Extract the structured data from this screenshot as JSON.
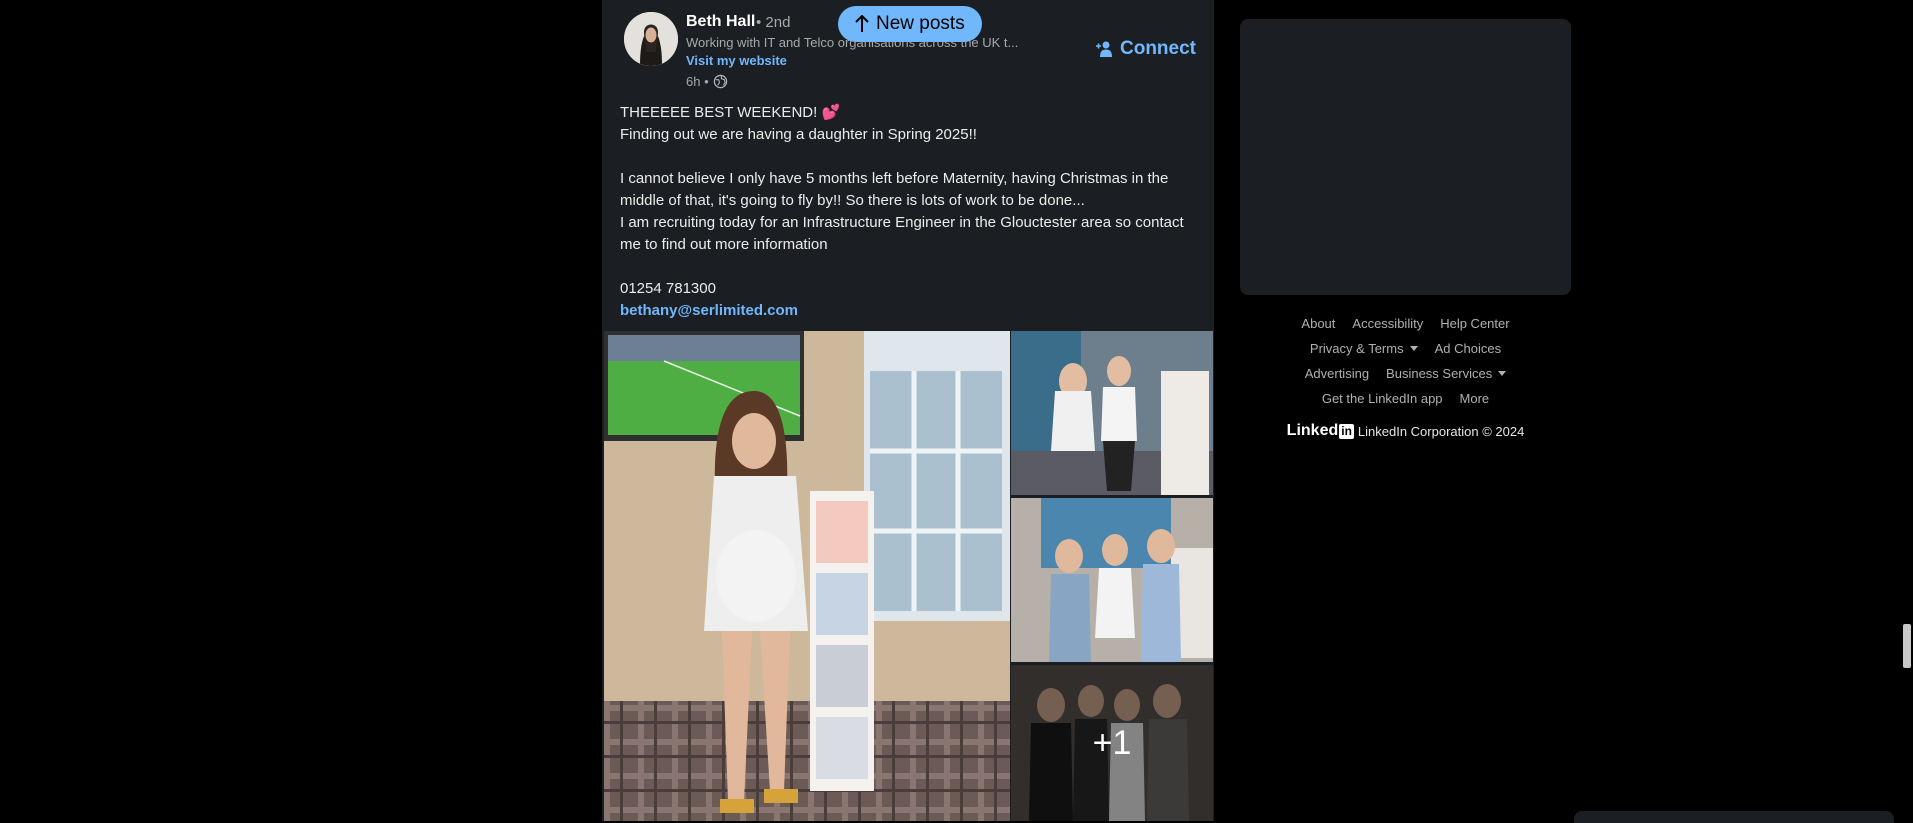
{
  "post": {
    "author": {
      "name": "Beth Hall",
      "degree": "• 2nd",
      "headline": "Working with IT and Telco organisations across the UK t...",
      "website_link": "Visit my website",
      "time": "6h •"
    },
    "connect_label": "Connect",
    "body": {
      "line1": "THEEEEE BEST WEEKEND! 💕",
      "line2": "Finding out we are having a daughter in Spring 2025!!",
      "line3": "I cannot believe I only have 5 months left before Maternity, having Christmas in the middle of that, it's going to fly by!! So there is lots of work to be done...",
      "line4": "I am recruiting today for an Infrastructure Engineer in the Glouctester area so contact me to find out more information",
      "phone": "01254 781300",
      "email": "bethany@serlimited.com"
    },
    "images": {
      "more_count": "+1"
    }
  },
  "new_posts_label": "New posts",
  "footer": {
    "row1": [
      "About",
      "Accessibility",
      "Help Center"
    ],
    "privacy_terms": "Privacy & Terms",
    "ad_choices": "Ad Choices",
    "advertising": "Advertising",
    "business_services": "Business Services",
    "get_app": "Get the LinkedIn app",
    "more": "More",
    "logo_text": "Linked",
    "logo_in": "in",
    "copyright": "LinkedIn Corporation © 2024"
  }
}
